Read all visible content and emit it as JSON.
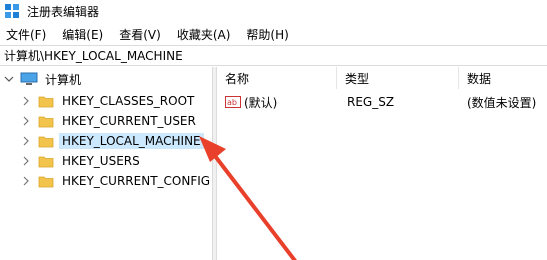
{
  "window": {
    "title": "注册表编辑器"
  },
  "menu": [
    {
      "label": "文件(F)"
    },
    {
      "label": "编辑(E)"
    },
    {
      "label": "查看(V)"
    },
    {
      "label": "收藏夹(A)"
    },
    {
      "label": "帮助(H)"
    }
  ],
  "address": "计算机\\HKEY_LOCAL_MACHINE",
  "tree": {
    "root": "计算机",
    "items": [
      {
        "label": "HKEY_CLASSES_ROOT"
      },
      {
        "label": "HKEY_CURRENT_USER"
      },
      {
        "label": "HKEY_LOCAL_MACHINE",
        "selected": true
      },
      {
        "label": "HKEY_USERS"
      },
      {
        "label": "HKEY_CURRENT_CONFIG"
      }
    ]
  },
  "values": {
    "columns": {
      "name": "名称",
      "type": "类型",
      "data": "数据"
    },
    "rows": [
      {
        "name": "(默认)",
        "type": "REG_SZ",
        "data": "(数值未设置)",
        "icon": "string-value-icon"
      }
    ]
  },
  "colors": {
    "selection": "#cce8ff",
    "annotation_arrow": "#e8402b",
    "folder": "#f3c44c"
  }
}
